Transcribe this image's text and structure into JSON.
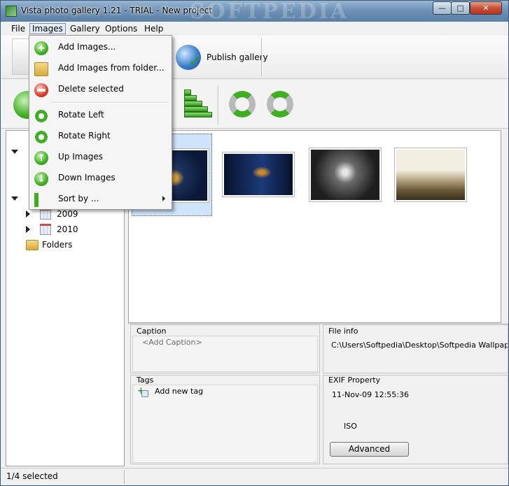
{
  "window": {
    "title": "Vista photo gallery 1.21 - TRIAL - New project",
    "watermark": "SOFTPEDIA",
    "controls": {
      "minimize": "—",
      "maximize": "□",
      "close": "✕"
    }
  },
  "menubar": {
    "items": [
      {
        "label": "File"
      },
      {
        "label": "Images",
        "active": true
      },
      {
        "label": "Gallery"
      },
      {
        "label": "Options"
      },
      {
        "label": "Help"
      }
    ]
  },
  "toolbar": {
    "publish_label": "Publish gallery",
    "icons": [
      "add-image-icon",
      "sort-by-icon",
      "rotate-left-icon",
      "rotate-right-icon",
      "globe-icon"
    ]
  },
  "images_menu": {
    "items": [
      {
        "label": "Add Images...",
        "icon": "add-images-icon"
      },
      {
        "label": "Add Images from folder...",
        "icon": "folder-add-icon"
      },
      {
        "label": "Delete selected",
        "icon": "delete-icon"
      },
      {
        "label": "Rotate Left",
        "icon": "rotate-left-icon"
      },
      {
        "label": "Rotate Right",
        "icon": "rotate-right-icon"
      },
      {
        "label": "Up Images",
        "icon": "arrow-up-icon"
      },
      {
        "label": "Down Images",
        "icon": "arrow-down-icon"
      },
      {
        "label": "Sort by ...",
        "icon": "sort-icon",
        "submenu": true
      }
    ]
  },
  "tree": {
    "years": [
      {
        "label": "2009"
      },
      {
        "label": "2010"
      }
    ],
    "folders_label": "Folders"
  },
  "gallery": {
    "thumbnails": [
      {
        "name": "softpedia-wallpaper-1",
        "selected": true
      },
      {
        "name": "softpedia-wallpaper-2",
        "selected": false
      },
      {
        "name": "thorns-wallpaper",
        "selected": false
      },
      {
        "name": "forest-fog-wallpaper",
        "selected": false
      }
    ]
  },
  "caption": {
    "title": "Caption",
    "placeholder": "<Add Caption>"
  },
  "fileinfo": {
    "title": "File info",
    "path": "C:\\Users\\Softpedia\\Desktop\\Softpedia Wallpapers\\"
  },
  "tags": {
    "title": "Tags",
    "add_label": "Add new tag"
  },
  "exif": {
    "title": "EXIF Property",
    "date": "11-Nov-09 12:55:36",
    "iso_label": "ISO",
    "advanced_button": "Advanced"
  },
  "status": {
    "text": "1/4 selected"
  },
  "colors": {
    "accent": "#3fae22",
    "selection": "#cfe3fb",
    "titlebar": "#6f92b6"
  }
}
